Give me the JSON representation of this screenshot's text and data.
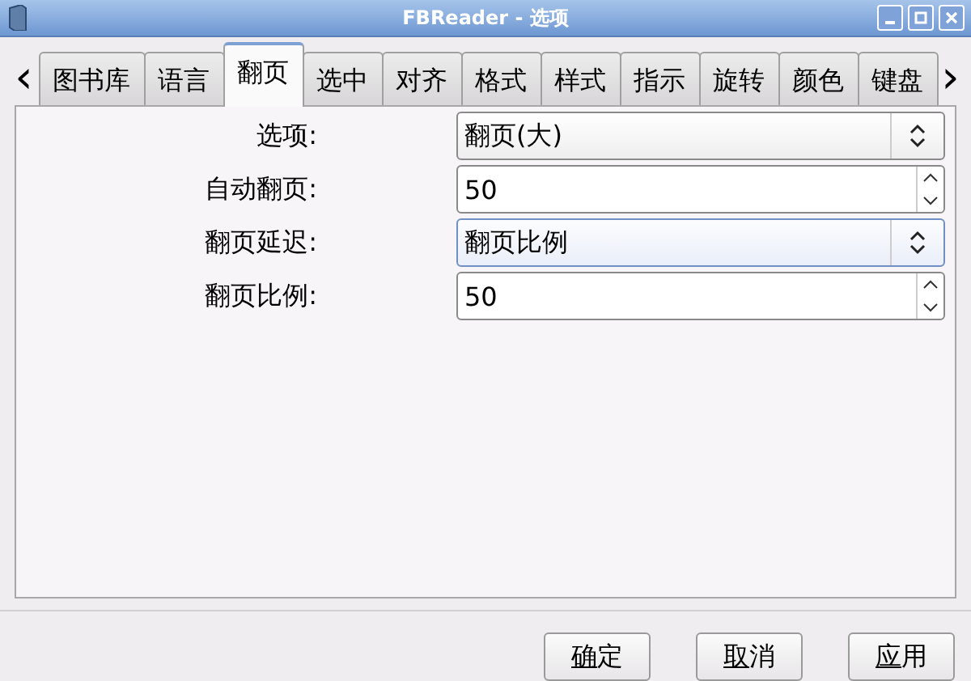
{
  "window": {
    "title": "FBReader - 选项"
  },
  "tab_scroll": {
    "left": "‹",
    "right": "›"
  },
  "tabs": [
    {
      "label": "图书库",
      "selected": false
    },
    {
      "label": "语言",
      "selected": false
    },
    {
      "label": "翻页",
      "selected": true
    },
    {
      "label": "选中",
      "selected": false
    },
    {
      "label": "对齐",
      "selected": false
    },
    {
      "label": "格式",
      "selected": false
    },
    {
      "label": "样式",
      "selected": false
    },
    {
      "label": "指示",
      "selected": false
    },
    {
      "label": "旋转",
      "selected": false
    },
    {
      "label": "颜色",
      "selected": false
    },
    {
      "label": "键盘",
      "selected": false
    }
  ],
  "fields": [
    {
      "label": "选项:",
      "kind": "combo",
      "value": "翻页(大)",
      "focused": false
    },
    {
      "label": "自动翻页:",
      "kind": "spin",
      "value": "50",
      "focused": false
    },
    {
      "label": "翻页延迟:",
      "kind": "combo",
      "value": "翻页比例",
      "focused": true
    },
    {
      "label": "翻页比例:",
      "kind": "spin",
      "value": "50",
      "focused": false
    }
  ],
  "buttons": [
    {
      "key": "确",
      "rest": "定"
    },
    {
      "key": "取",
      "rest": "消"
    },
    {
      "key": "应",
      "rest": "用"
    }
  ]
}
